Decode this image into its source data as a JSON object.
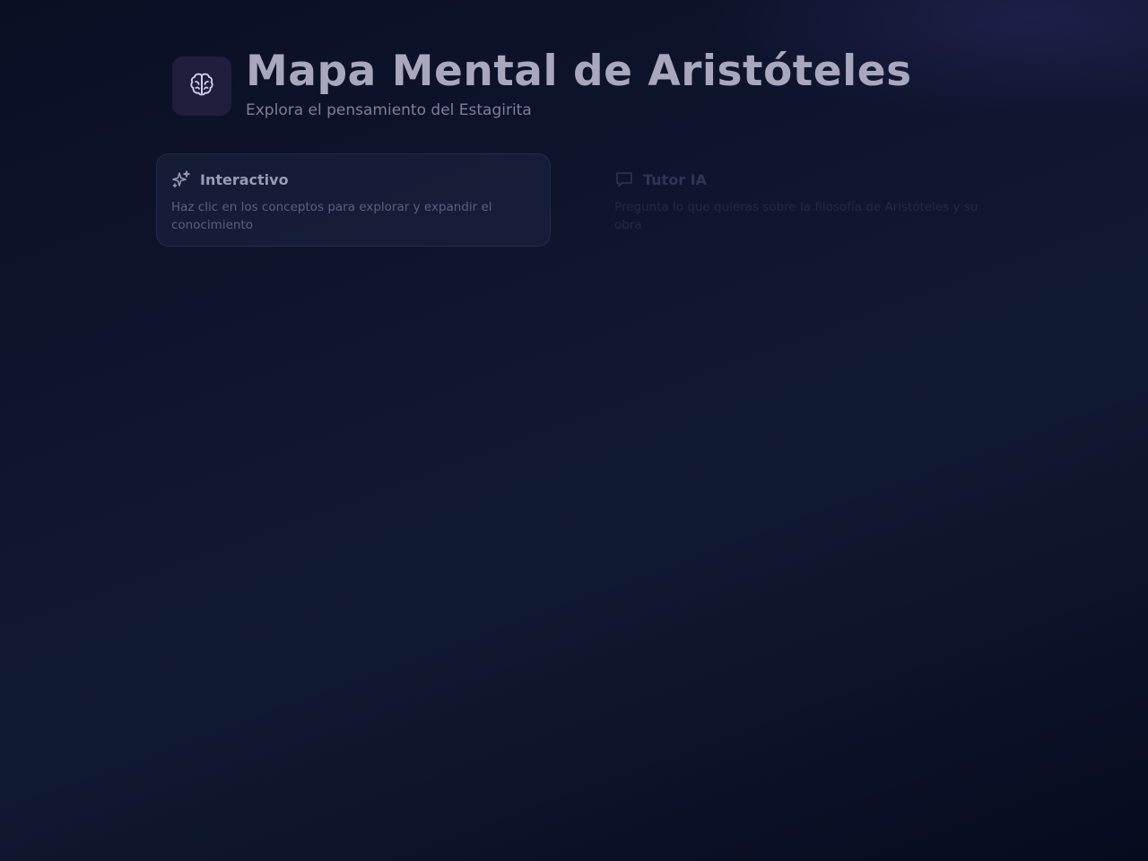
{
  "header": {
    "logo_icon": "brain-icon",
    "title": "Mapa Mental de Aristóteles",
    "subtitle": "Explora el pensamiento del Estagirita"
  },
  "cards": [
    {
      "icon": "sparkles-icon",
      "title": "Interactivo",
      "description": "Haz clic en los conceptos para explorar y expandir el conocimiento"
    },
    {
      "icon": "chat-icon",
      "title": "Tutor IA",
      "description": "Pregunta lo que quieras sobre la filosofía de Aristóteles y su obra"
    }
  ],
  "colors": {
    "background": "#0f1630",
    "title": "#a8a7bd",
    "logo_box": "#1f1e3d",
    "accent_icon": "#c9c6e8"
  }
}
